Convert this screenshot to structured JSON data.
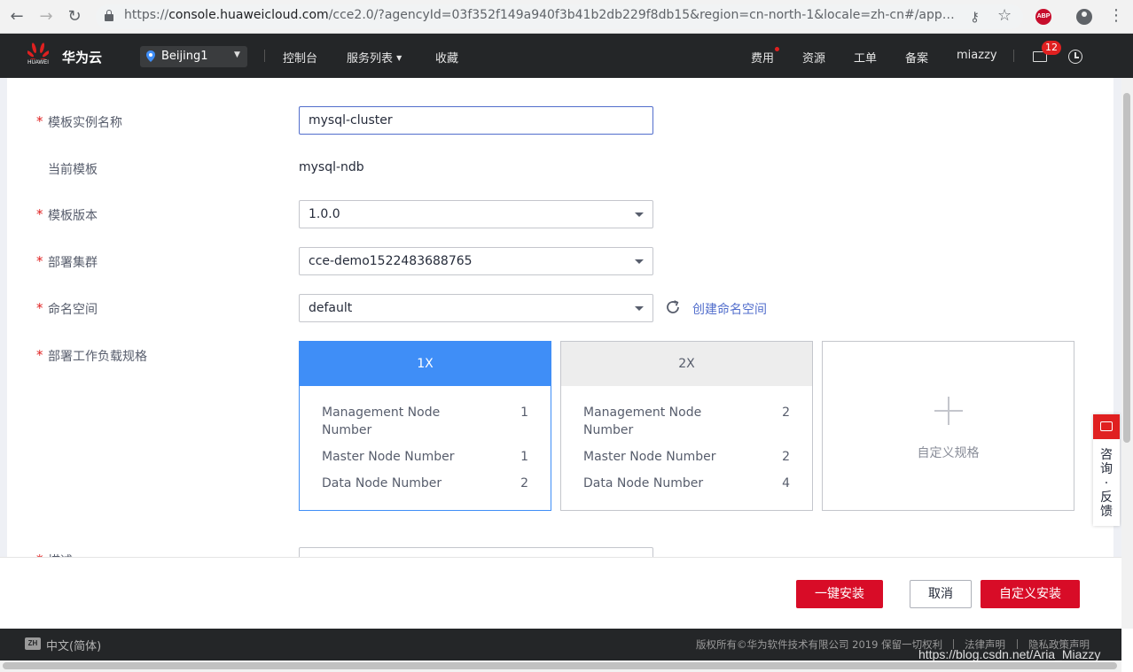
{
  "browser": {
    "url_prefix": "https://",
    "url_domain": "console.huaweicloud.com",
    "url_rest": "/cce2.0/?agencyId=03f352f149a940f3b41b2db229f8db15&region=cn-north-1&locale=zh-cn#/app/chartMark...",
    "abp_label": "ABP"
  },
  "header": {
    "logo_text": "HUAWEI",
    "brand": "华为云",
    "region": "Beijing1",
    "nav_left": [
      "控制台",
      "服务列表",
      "收藏"
    ],
    "nav_right": [
      "费用",
      "资源",
      "工单",
      "备案",
      "miazzy"
    ],
    "mail_badge": "12"
  },
  "form": {
    "instance_name_label": "模板实例名称",
    "instance_name_value": "mysql-cluster",
    "current_template_label": "当前模板",
    "current_template_value": "mysql-ndb",
    "version_label": "模板版本",
    "version_value": "1.0.0",
    "cluster_label": "部署集群",
    "cluster_value": "cce-demo1522483688765",
    "namespace_label": "命名空间",
    "namespace_value": "default",
    "create_namespace_link": "创建命名空间",
    "spec_label": "部署工作负载规格",
    "desc_label": "描述",
    "specs": [
      {
        "title": "1X",
        "rows": [
          {
            "label": "Management Node Number",
            "value": "1"
          },
          {
            "label": "Master Node Number",
            "value": "1"
          },
          {
            "label": "Data Node Number",
            "value": "2"
          }
        ]
      },
      {
        "title": "2X",
        "rows": [
          {
            "label": "Management Node Number",
            "value": "2"
          },
          {
            "label": "Master Node Number",
            "value": "2"
          },
          {
            "label": "Data Node Number",
            "value": "4"
          }
        ]
      }
    ],
    "custom_spec_label": "自定义规格"
  },
  "feedback": {
    "label": "咨询·反馈"
  },
  "actions": {
    "one_click_install": "一键安装",
    "cancel": "取消",
    "custom_install": "自定义安装"
  },
  "footer": {
    "lang_icon_text": "ZH",
    "language": "中文(简体)",
    "copyright": "版权所有©华为软件技术有限公司 2019 保留一切权利",
    "legal": "法律声明",
    "privacy": "隐私政策声明"
  },
  "watermark": "https://blog.csdn.net/Aria_Miazzy",
  "colors": {
    "accent_blue": "#3f8ef7",
    "brand_red": "#d80c27",
    "header_bg": "#242628"
  }
}
